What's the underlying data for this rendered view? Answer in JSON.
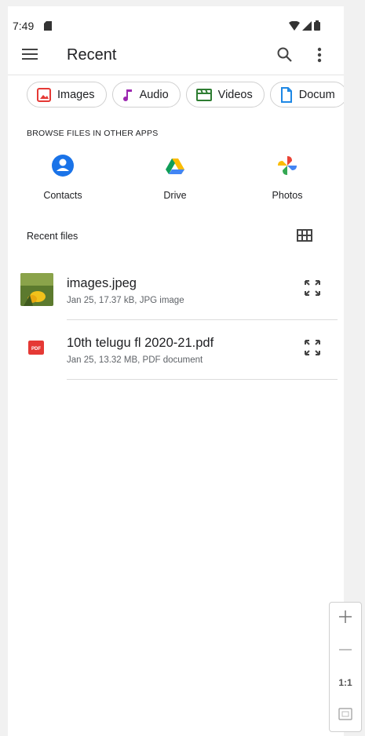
{
  "status": {
    "time": "7:49"
  },
  "header": {
    "title": "Recent"
  },
  "chips": [
    {
      "label": "Images",
      "icon": "image-icon",
      "color": "#e53935"
    },
    {
      "label": "Audio",
      "icon": "music-note-icon",
      "color": "#9c27b0"
    },
    {
      "label": "Videos",
      "icon": "video-icon",
      "color": "#2e7d32"
    },
    {
      "label": "Docum",
      "icon": "document-icon",
      "color": "#1e88e5"
    }
  ],
  "browse": {
    "title": "BROWSE FILES IN OTHER APPS",
    "apps": [
      {
        "label": "Contacts",
        "icon": "contacts-icon"
      },
      {
        "label": "Drive",
        "icon": "drive-icon"
      },
      {
        "label": "Photos",
        "icon": "photos-icon"
      }
    ]
  },
  "recent": {
    "title": "Recent files",
    "files": [
      {
        "name": "images.jpeg",
        "meta": "Jan 25, 17.37 kB, JPG image",
        "thumb": "image-thumbnail"
      },
      {
        "name": "10th telugu fl 2020-21.pdf",
        "meta": "Jan 25, 13.32 MB, PDF document",
        "thumb": "pdf-icon",
        "badge": "PDF"
      }
    ]
  },
  "zoom": {
    "ratio_label": "1:1"
  },
  "colors": {
    "accent": "#1a73e8",
    "pdf": "#e53935"
  }
}
